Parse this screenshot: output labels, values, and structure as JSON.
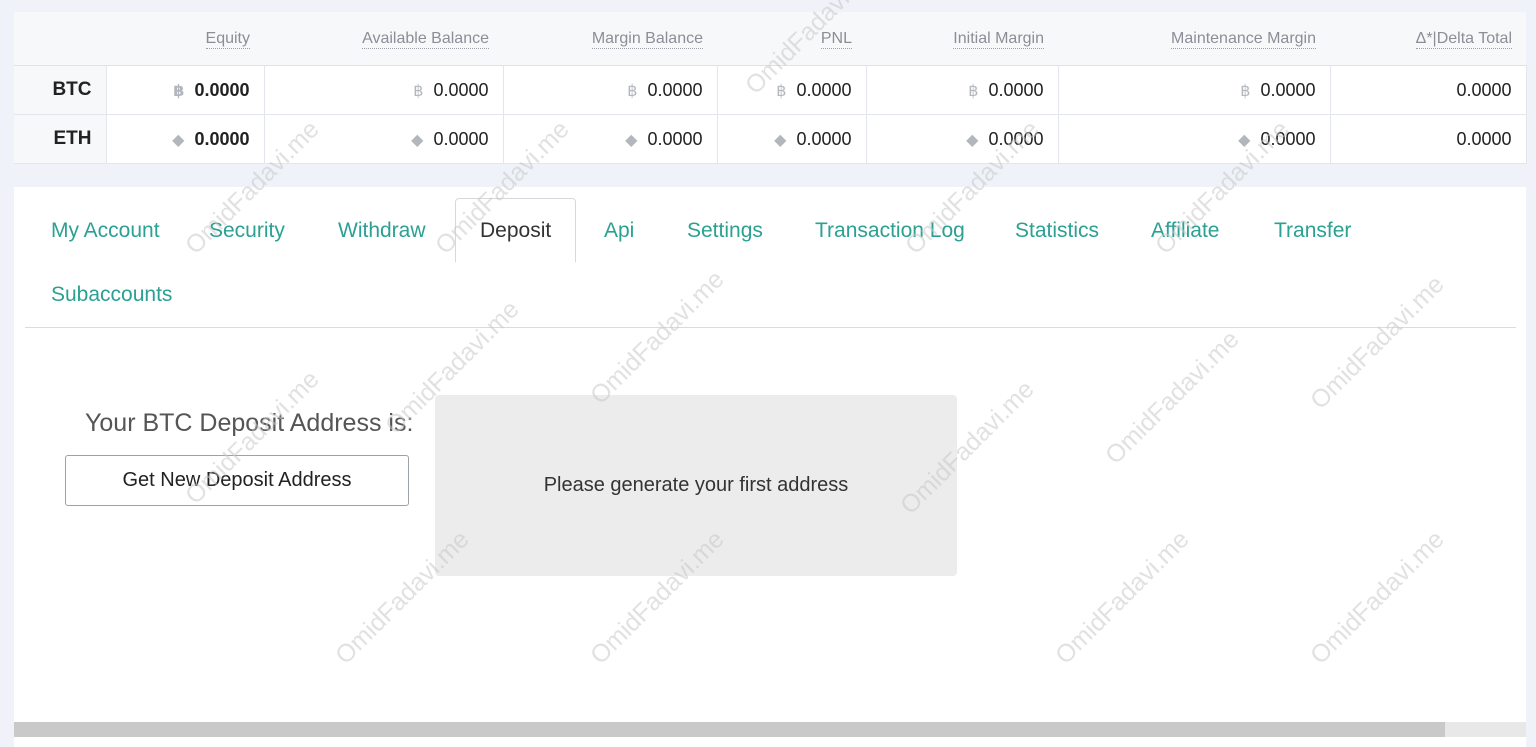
{
  "balances": {
    "columns": [
      "",
      "Equity",
      "Available Balance",
      "Margin Balance",
      "PNL",
      "Initial Margin",
      "Maintenance Margin",
      "Δ*|Delta Total"
    ],
    "rows": [
      {
        "currency": "BTC",
        "icon": "bitcoin-icon",
        "icon_glyph": "฿",
        "equity": "0.0000",
        "available_balance": "0.0000",
        "margin_balance": "0.0000",
        "pnl": "0.0000",
        "initial_margin": "0.0000",
        "maintenance_margin": "0.0000",
        "delta_total": "0.0000"
      },
      {
        "currency": "ETH",
        "icon": "ethereum-icon",
        "icon_glyph": "◆",
        "equity": "0.0000",
        "available_balance": "0.0000",
        "margin_balance": "0.0000",
        "pnl": "0.0000",
        "initial_margin": "0.0000",
        "maintenance_margin": "0.0000",
        "delta_total": "0.0000"
      }
    ]
  },
  "tabs": [
    {
      "label": "My Account",
      "active": false
    },
    {
      "label": "Security",
      "active": false
    },
    {
      "label": "Withdraw",
      "active": false
    },
    {
      "label": "Deposit",
      "active": true
    },
    {
      "label": "Api",
      "active": false
    },
    {
      "label": "Settings",
      "active": false
    },
    {
      "label": "Transaction Log",
      "active": false
    },
    {
      "label": "Statistics",
      "active": false
    },
    {
      "label": "Affiliate",
      "active": false
    },
    {
      "label": "Transfer",
      "active": false
    },
    {
      "label": "Subaccounts",
      "active": false
    }
  ],
  "deposit": {
    "address_label": "Your BTC Deposit Address is:",
    "new_address_button": "Get New Deposit Address",
    "address_placeholder": "Please generate your first address"
  },
  "watermark": "OmidFadavi.me",
  "colors": {
    "accent": "#2aa193",
    "page_background": "#eff2f8",
    "address_box": "#ececec"
  }
}
